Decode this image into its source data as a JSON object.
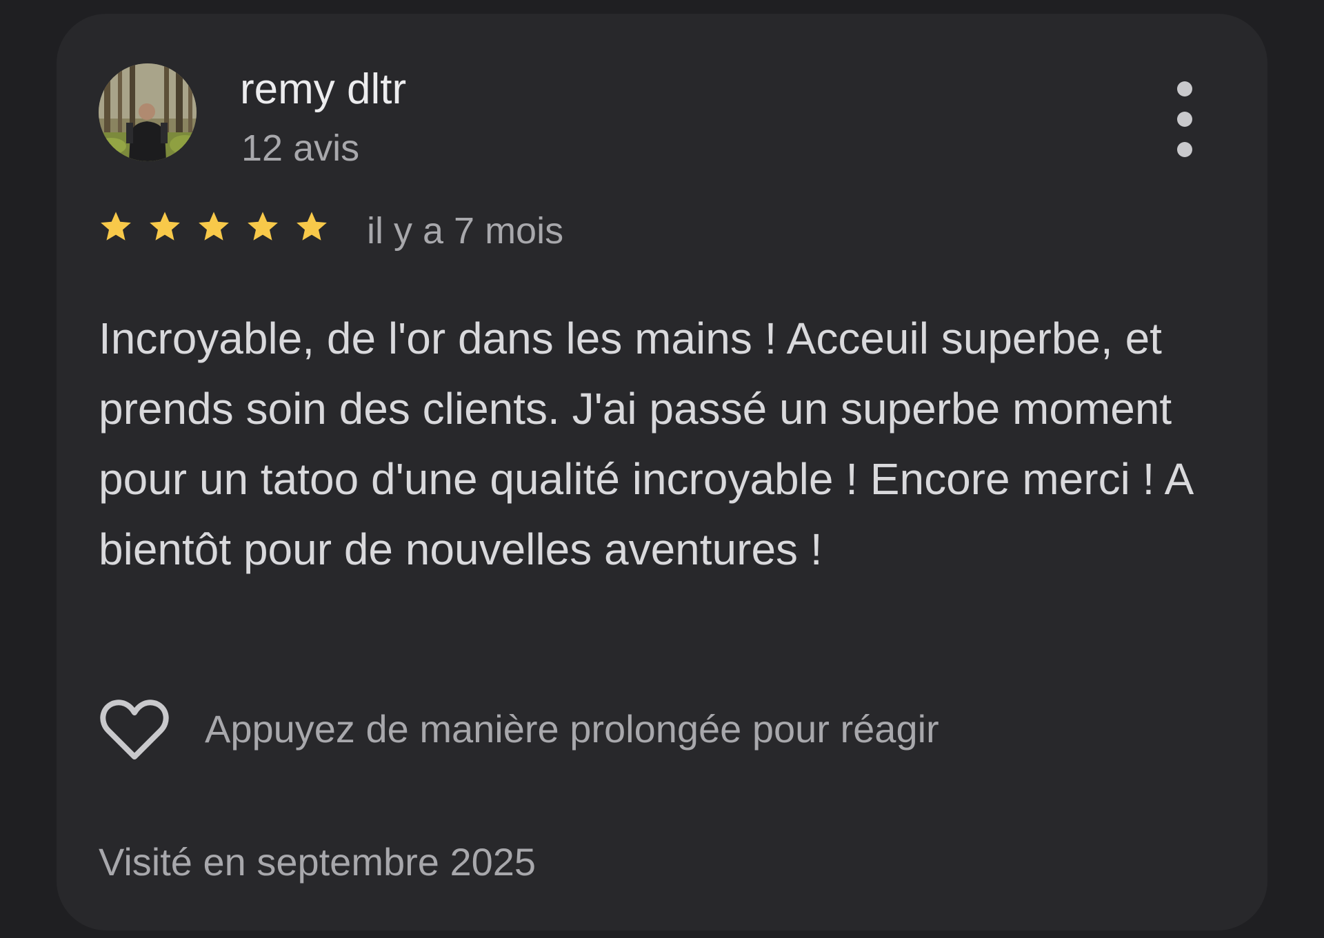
{
  "review": {
    "reviewer": {
      "name": "remy dltr",
      "review_count": "12 avis",
      "avatar_icon": "user-avatar-photo"
    },
    "rating": {
      "stars_filled": 5,
      "stars_total": 5,
      "star_color": "#f8c94a"
    },
    "time_ago": "il y a 7 mois",
    "text": "Incroyable, de l'or dans les mains ! Acceuil superbe, et prends soin des clients. J'ai passé un superbe moment pour un tatoo d'une qualité incroyable ! Encore merci ! A bientôt pour de nouvelles aventures !",
    "react_hint": "Appuyez de manière prolongée pour réagir",
    "visit_date": "Visité en septembre 2025",
    "more_icon": "more-vertical-icon",
    "react_icon": "heart-outline-icon"
  },
  "colors": {
    "page_background": "#1f1f22",
    "card_background": "#28282b",
    "primary_text": "#ececee",
    "secondary_text": "#a8a8ac",
    "body_text": "#d9d9dc"
  }
}
